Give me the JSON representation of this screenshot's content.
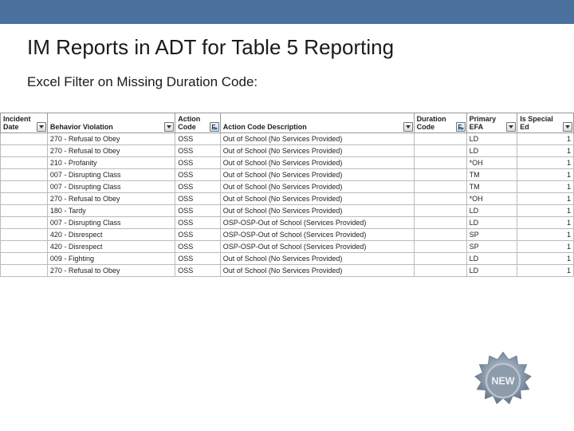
{
  "title": "IM Reports in ADT for Table 5 Reporting",
  "subtitle": "Excel Filter on Missing Duration Code:",
  "badge_text": "NEW",
  "table": {
    "headers": {
      "incident_date": "Incident Date",
      "behavior_violation": "Behavior Violation",
      "action_code": "Action Code",
      "action_code_desc": "Action Code Description",
      "duration_code": "Duration Code",
      "primary_efa": "Primary EFA",
      "is_special_ed": "Is Special Ed"
    },
    "rows": [
      {
        "bv": "270 - Refusal to Obey",
        "ac": "OSS",
        "desc": "Out of School (No Services Provided)",
        "efa": "LD",
        "sped": "1"
      },
      {
        "bv": "270 - Refusal to Obey",
        "ac": "OSS",
        "desc": "Out of School (No Services Provided)",
        "efa": "LD",
        "sped": "1"
      },
      {
        "bv": "210 - Profanity",
        "ac": "OSS",
        "desc": "Out of School (No Services Provided)",
        "efa": "*OH",
        "sped": "1"
      },
      {
        "bv": "007 - Disrupting Class",
        "ac": "OSS",
        "desc": "Out of School (No Services Provided)",
        "efa": "TM",
        "sped": "1"
      },
      {
        "bv": "007 - Disrupting Class",
        "ac": "OSS",
        "desc": "Out of School (No Services Provided)",
        "efa": "TM",
        "sped": "1"
      },
      {
        "bv": "270 - Refusal to Obey",
        "ac": "OSS",
        "desc": "Out of School (No Services Provided)",
        "efa": "*OH",
        "sped": "1"
      },
      {
        "bv": "180 - Tardy",
        "ac": "OSS",
        "desc": "Out of School (No Services Provided)",
        "efa": "LD",
        "sped": "1"
      },
      {
        "bv": "007 - Disrupting Class",
        "ac": "OSS",
        "desc": "OSP-OSP-Out of School (Services Provided)",
        "efa": "LD",
        "sped": "1"
      },
      {
        "bv": "420 - Disrespect",
        "ac": "OSS",
        "desc": "OSP-OSP-Out of School (Services Provided)",
        "efa": "SP",
        "sped": "1"
      },
      {
        "bv": "420 - Disrespect",
        "ac": "OSS",
        "desc": "OSP-OSP-Out of School (Services Provided)",
        "efa": "SP",
        "sped": "1"
      },
      {
        "bv": "009 - Fighting",
        "ac": "OSS",
        "desc": "Out of School (No Services Provided)",
        "efa": "LD",
        "sped": "1"
      },
      {
        "bv": "270 - Refusal to Obey",
        "ac": "OSS",
        "desc": "Out of School (No Services Provided)",
        "efa": "LD",
        "sped": "1"
      }
    ]
  }
}
